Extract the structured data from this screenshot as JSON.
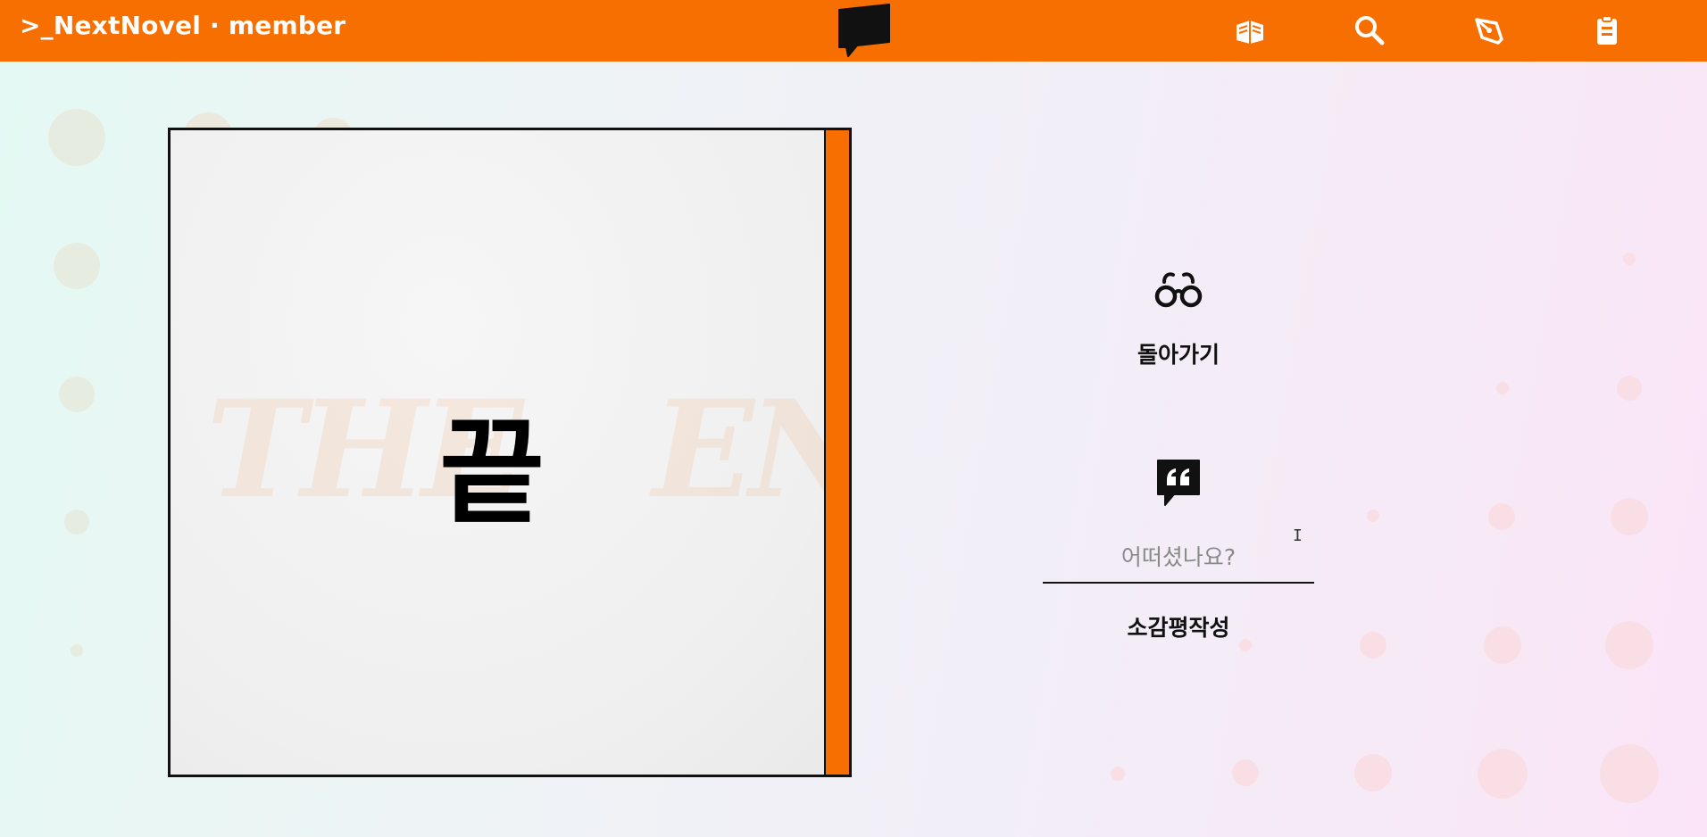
{
  "header": {
    "brand": ">_NextNovel",
    "separator": "·",
    "user": "member",
    "nav": [
      {
        "icon": "books-icon"
      },
      {
        "icon": "search-icon"
      },
      {
        "icon": "pen-icon"
      },
      {
        "icon": "clipboard-icon"
      }
    ]
  },
  "book": {
    "ghost_left": "THE",
    "ghost_right": "END.",
    "main_text": "끝"
  },
  "actions": {
    "back_label": "돌아가기",
    "review_placeholder": "어떠셨나요?",
    "review_submit_label": "소감평작성"
  },
  "colors": {
    "accent": "#f76f00",
    "text": "#111111"
  }
}
